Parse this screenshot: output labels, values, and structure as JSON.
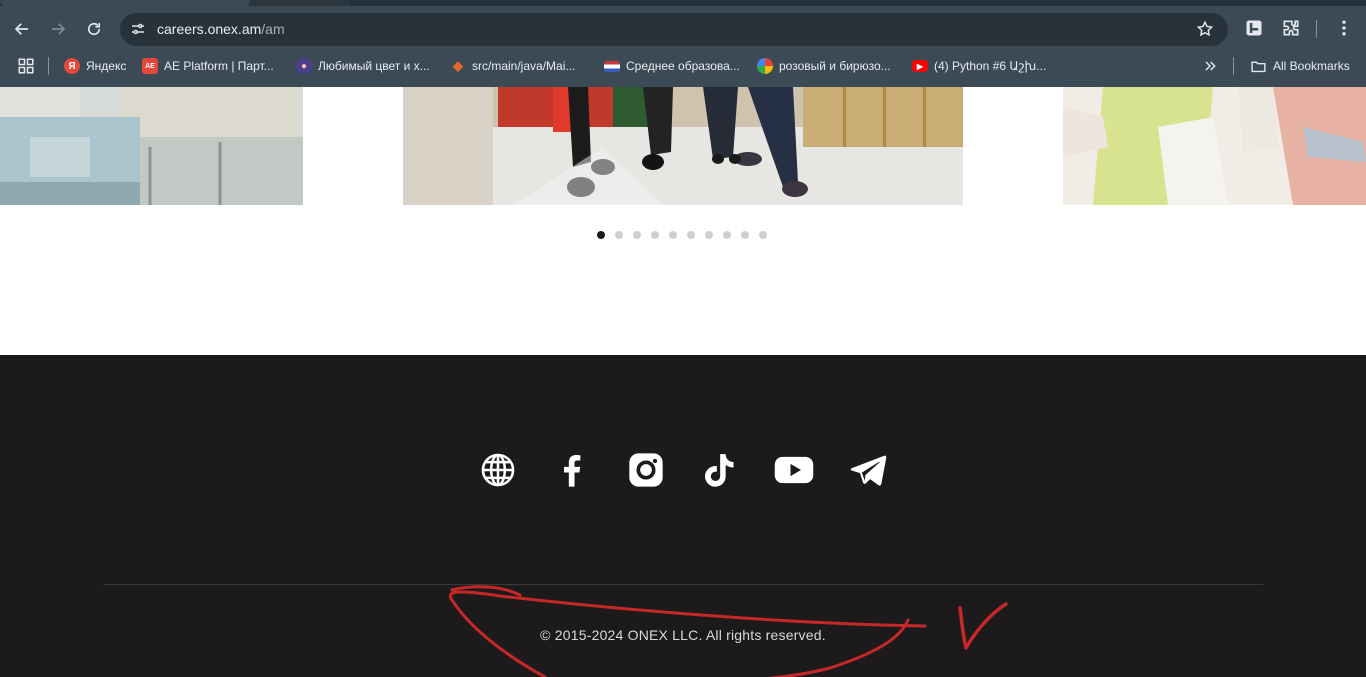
{
  "browser": {
    "url_host": "careers.onex.am",
    "url_path": "/am",
    "bookmarks": [
      {
        "label": "Яндекс",
        "icon": "yandex-icon",
        "color": "#e5483a",
        "glyph": "Я"
      },
      {
        "label": "AE Platform | Парт...",
        "icon": "ae-platform-icon",
        "color": "#e5483a",
        "glyph": "AE"
      },
      {
        "label": "Любимый цвет и х...",
        "icon": "person-icon",
        "color": "#4b3f8c",
        "glyph": "●"
      },
      {
        "label": "src/main/java/Mai...",
        "icon": "gitlab-icon",
        "color": "#e26a2c",
        "glyph": "◆"
      },
      {
        "label": "Среднее образова...",
        "icon": "flag-icon",
        "color": "#8aa2c8",
        "glyph": "▬"
      },
      {
        "label": "розовый и бирюзо...",
        "icon": "google-icon",
        "color": "#ffffff",
        "glyph": "G"
      },
      {
        "label": "(4) Python #6 Աշխ...",
        "icon": "youtube-icon",
        "color": "#ff0000",
        "glyph": "▶"
      }
    ],
    "all_bookmarks": "All Bookmarks"
  },
  "carousel": {
    "slide_count": 10,
    "active_index": 0
  },
  "footer": {
    "social": [
      "globe-icon",
      "facebook-icon",
      "instagram-icon",
      "tiktok-icon",
      "youtube-icon",
      "telegram-icon"
    ],
    "copyright": "© 2015-2024 ONEX LLC. All rights reserved."
  },
  "colors": {
    "chrome": "#3c4a56",
    "footer": "#1c1a1b",
    "annotation": "#c62828"
  }
}
